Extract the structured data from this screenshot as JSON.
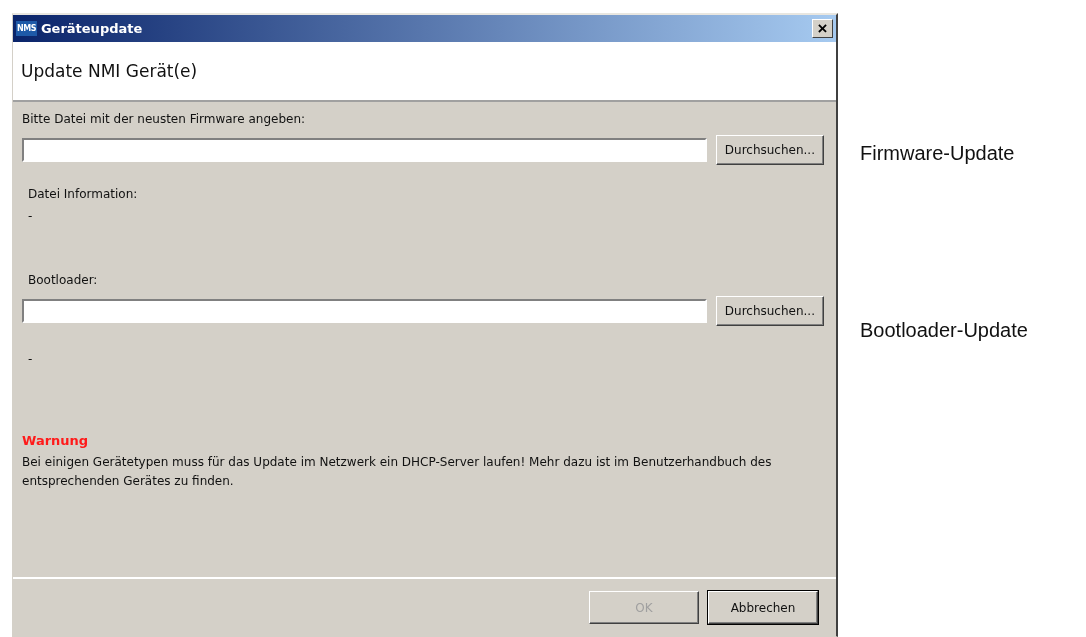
{
  "window": {
    "icon_text": "NMS",
    "title": "Geräteupdate",
    "close": "×"
  },
  "header": {
    "title": "Update NMI Gerät(e)"
  },
  "firmware": {
    "label": "Bitte Datei mit der neusten Firmware angeben:",
    "browse": "Durchsuchen...",
    "info_label": "Datei Information:",
    "info_value": "-"
  },
  "bootloader": {
    "label": "Bootloader:",
    "browse": "Durchsuchen...",
    "info_value": "-"
  },
  "warning": {
    "title": "Warnung",
    "text": "Bei einigen Gerätetypen muss für das Update im Netzwerk ein DHCP-Server laufen! Mehr dazu ist im Benutzerhandbuch des entsprechenden Gerätes zu finden."
  },
  "buttons": [
    {
      "label": "OK",
      "disabled": true,
      "default": false
    },
    {
      "label": "Abbrechen",
      "disabled": false,
      "default": true
    }
  ],
  "annotations": [
    "Firmware-Update",
    "Bootloader-Update"
  ]
}
